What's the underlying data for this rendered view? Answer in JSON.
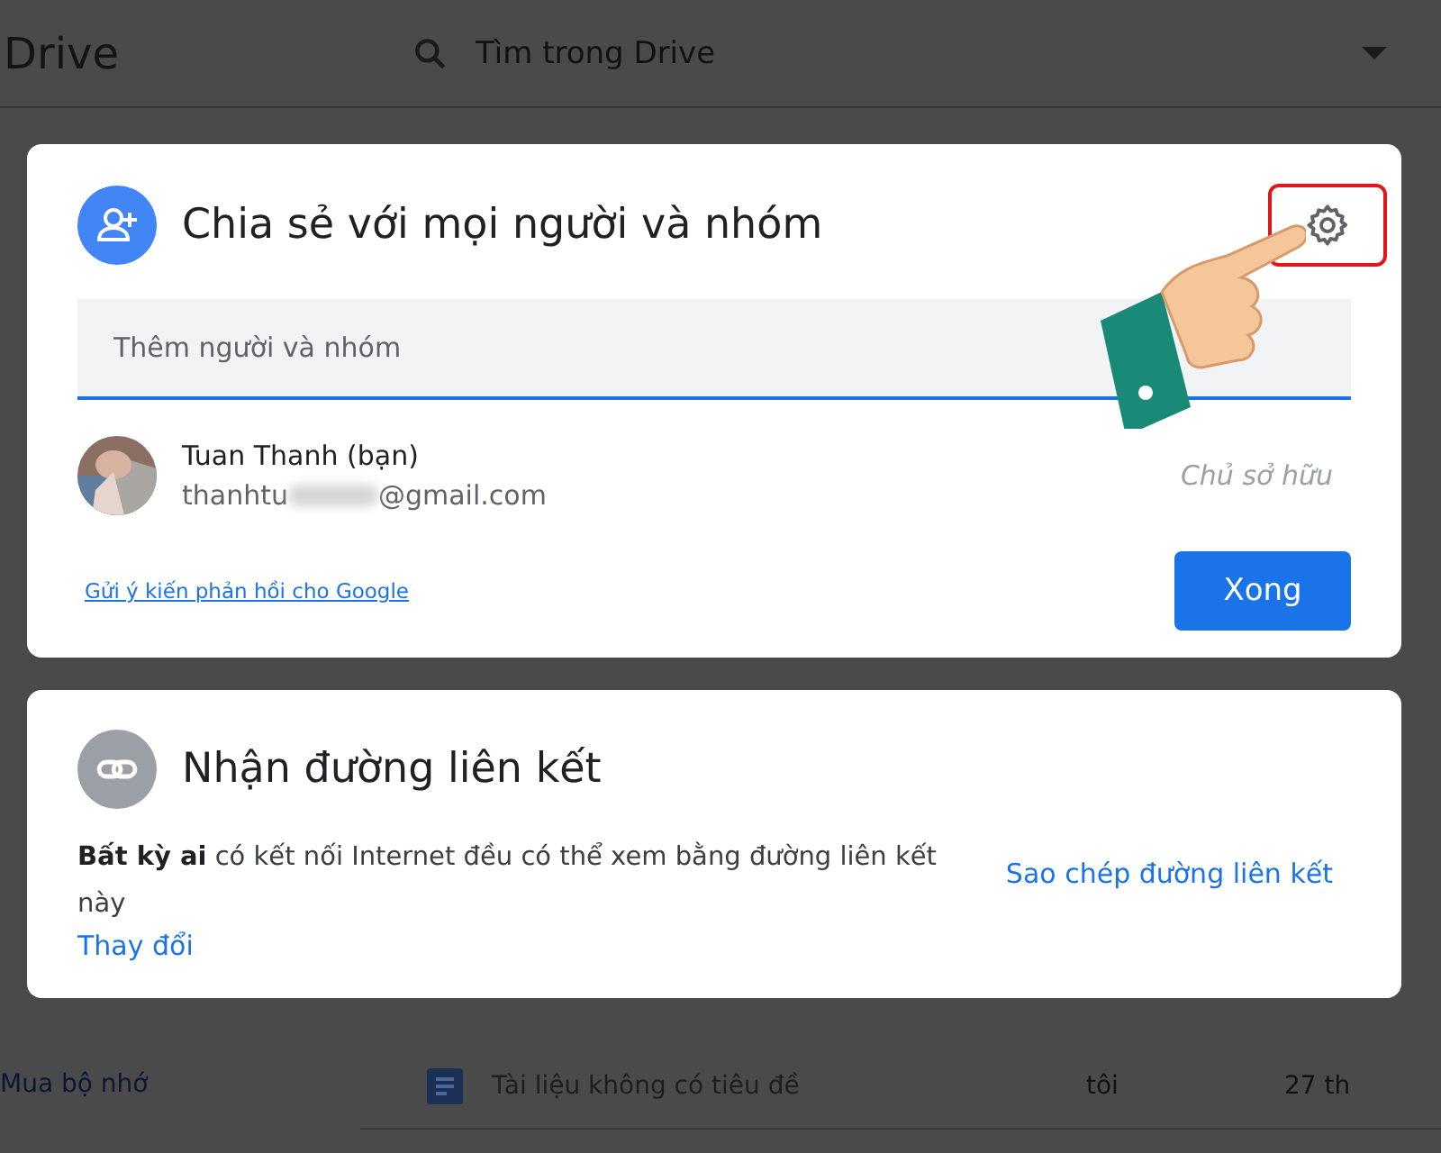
{
  "app_bar": {
    "title": "Drive",
    "search": {
      "placeholder": "Tìm trong Drive"
    }
  },
  "share_dialog": {
    "title": "Chia sẻ với mọi người và nhóm",
    "add_field": {
      "placeholder": "Thêm người và nhóm"
    },
    "people": [
      {
        "name": "Tuan Thanh (bạn)",
        "email_start": "thanhtu",
        "email_end": "@gmail.com",
        "role": "Chủ sở hữu"
      }
    ],
    "settings_highlighted": true,
    "feedback_link": "Gửi ý kiến phản hồi cho Google",
    "done_button": "Xong"
  },
  "link_dialog": {
    "title": "Nhận đường liên kết",
    "description": "**Bất kỳ ai** có kết nối Internet đều có thể xem bằng đường liên kết này",
    "change_link": "Thay đổi",
    "copy_link": "Sao chép đường liên kết"
  },
  "file_rows": [
    {
      "name": "Tài liệu không có tiêu đề",
      "owner": "tôi",
      "date": "27 th"
    }
  ],
  "sidebar": {
    "storage_link": "Mua bộ nhớ"
  }
}
